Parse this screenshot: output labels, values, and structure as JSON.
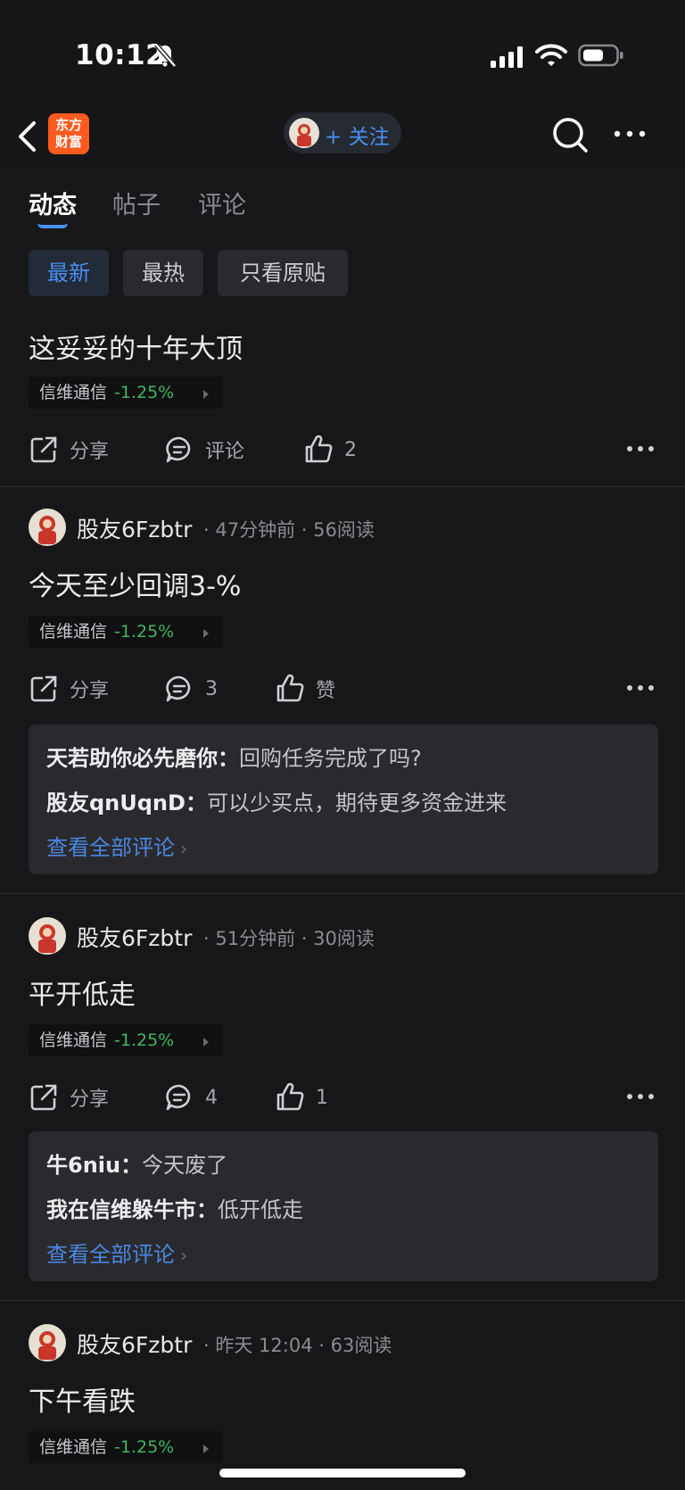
{
  "status": {
    "time": "10:12"
  },
  "nav": {
    "logo": "东方\n财富",
    "follow": "+ 关注"
  },
  "tabs": [
    "动态",
    "帖子",
    "评论"
  ],
  "filters": [
    "最新",
    "最热",
    "只看原贴"
  ],
  "posts": [
    {
      "text": "这妥妥的十年大顶",
      "stock": {
        "name": "信维通信",
        "pct": "-1.25%"
      },
      "share": "分享",
      "comment": "评论",
      "like": "2"
    },
    {
      "author": "股友6Fzbtr",
      "time": "47分钟前",
      "reads": "56阅读",
      "text": "今天至少回调3-%",
      "stock": {
        "name": "信维通信",
        "pct": "-1.25%"
      },
      "share": "分享",
      "comment": "3",
      "like": "赞",
      "comments": [
        {
          "who": "天若助你必先磨你：",
          "body": "回购任务完成了吗?"
        },
        {
          "who": "股友qnUqnD：",
          "body": "可以少买点，期待更多资金进来"
        }
      ],
      "see_all": "查看全部评论"
    },
    {
      "author": "股友6Fzbtr",
      "time": "51分钟前",
      "reads": "30阅读",
      "text": "平开低走",
      "stock": {
        "name": "信维通信",
        "pct": "-1.25%"
      },
      "share": "分享",
      "comment": "4",
      "like": "1",
      "comments": [
        {
          "who": "牛6niu：",
          "body": "今天废了"
        },
        {
          "who": "我在信维躲牛市：",
          "body": "低开低走"
        }
      ],
      "see_all": "查看全部评论"
    },
    {
      "author": "股友6Fzbtr",
      "time": "昨天 12:04",
      "reads": "63阅读",
      "text": "下午看跌",
      "stock": {
        "name": "信维通信",
        "pct": "-1.25%"
      }
    }
  ],
  "colors": {
    "accent": "#4a8ff0",
    "down": "#3fb65f",
    "brand": "#ff5a1f"
  }
}
